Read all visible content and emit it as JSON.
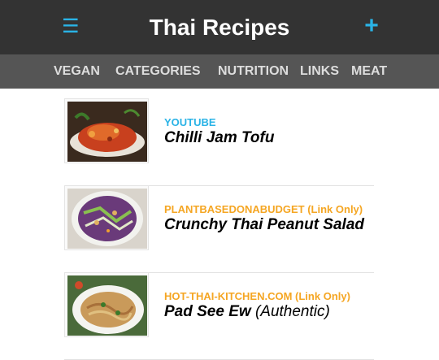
{
  "header": {
    "title": "Thai Recipes",
    "menu_icon": "hamburger-menu-icon",
    "add_icon": "plus-icon",
    "accent_color": "#2ab3e6"
  },
  "nav": {
    "items": [
      {
        "label": "VEGAN"
      },
      {
        "label": "CATEGORIES"
      },
      {
        "label": "NUTRITION"
      },
      {
        "label": "LINKS"
      },
      {
        "label": "MEAT"
      }
    ]
  },
  "recipes": [
    {
      "source": "YOUTUBE",
      "name": "Chilli Jam Tofu",
      "extra": "",
      "source_color": "#2ab3e6"
    },
    {
      "source": "PLANTBASEDONABUDGET (Link Only)",
      "name": "Crunchy Thai Peanut Salad",
      "extra": "",
      "source_color": "#f5a623"
    },
    {
      "source": "HOT-THAI-KITCHEN.COM (Link Only)",
      "name": "Pad See Ew",
      "extra": "(Authentic)",
      "source_color": "#f5a623"
    }
  ]
}
